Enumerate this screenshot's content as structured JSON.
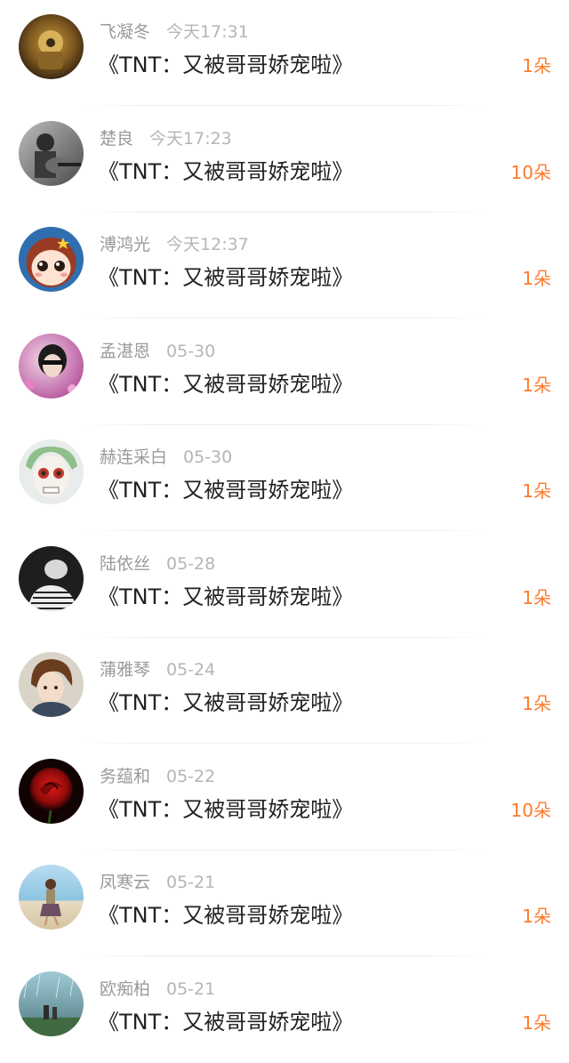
{
  "items": [
    {
      "name": "飞凝冬",
      "time": "今天17:31",
      "title": "《TNT：又被哥哥娇宠啦》",
      "count": "1朵",
      "avatar": "armored-character-avatar"
    },
    {
      "name": "楚良",
      "time": "今天17:23",
      "title": "《TNT：又被哥哥娇宠啦》",
      "count": "10朵",
      "avatar": "guitar-player-avatar"
    },
    {
      "name": "溥鸿光",
      "time": "今天12:37",
      "title": "《TNT：又被哥哥娇宠啦》",
      "count": "1朵",
      "avatar": "cartoon-girl-avatar"
    },
    {
      "name": "孟湛恩",
      "time": "05-30",
      "title": "《TNT：又被哥哥娇宠啦》",
      "count": "1朵",
      "avatar": "person-pink-flowers-avatar"
    },
    {
      "name": "赫连采白",
      "time": "05-30",
      "title": "《TNT：又被哥哥娇宠啦》",
      "count": "1朵",
      "avatar": "skull-makeup-face-avatar"
    },
    {
      "name": "陆依丝",
      "time": "05-28",
      "title": "《TNT：又被哥哥娇宠啦》",
      "count": "1朵",
      "avatar": "monochrome-portrait-avatar"
    },
    {
      "name": "蒲雅琴",
      "time": "05-24",
      "title": "《TNT：又被哥哥娇宠啦》",
      "count": "1朵",
      "avatar": "anime-man-avatar"
    },
    {
      "name": "务蕴和",
      "time": "05-22",
      "title": "《TNT：又被哥哥娇宠啦》",
      "count": "10朵",
      "avatar": "red-rose-avatar"
    },
    {
      "name": "凤寒云",
      "time": "05-21",
      "title": "《TNT：又被哥哥娇宠啦》",
      "count": "1朵",
      "avatar": "girl-on-beach-avatar"
    },
    {
      "name": "欧痴柏",
      "time": "05-21",
      "title": "《TNT：又被哥哥娇宠啦》",
      "count": "1朵",
      "avatar": "rainy-landscape-avatar"
    }
  ],
  "colors": {
    "count": "#ff7a2a",
    "name": "#9a9a9a",
    "time": "#b5b5b5",
    "title": "#222222"
  }
}
